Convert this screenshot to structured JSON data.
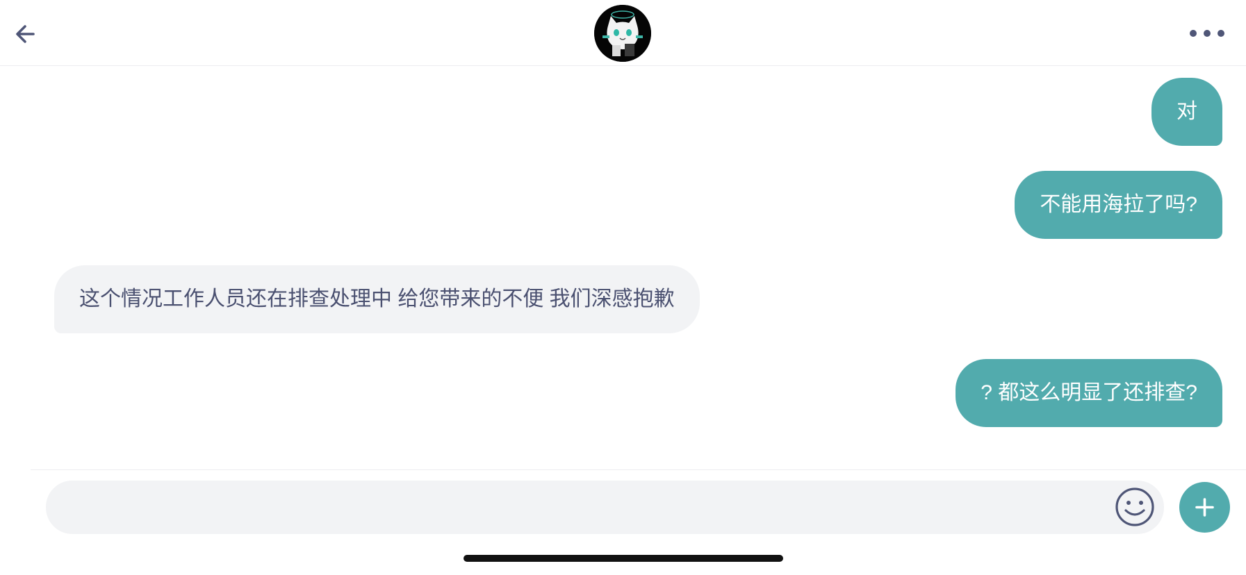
{
  "header": {
    "back_icon": "arrow-left-icon",
    "avatar_icon": "cat-avatar-icon",
    "more_icon": "more-dots-icon"
  },
  "messages": [
    {
      "sender": "me",
      "text": "对"
    },
    {
      "sender": "me",
      "text": "不能用海拉了吗?"
    },
    {
      "sender": "agent",
      "text": "这个情况工作人员还在排查处理中 给您带来的不便 我们深感抱歉"
    },
    {
      "sender": "me",
      "text": "? 都这么明显了还排查?"
    }
  ],
  "composer": {
    "value": "",
    "emoji_icon": "emoji-icon",
    "plus_icon": "plus-icon"
  },
  "colors": {
    "accent": "#52ABAD",
    "bubble_incoming": "#F2F3F5",
    "text_incoming": "#4A5070"
  }
}
